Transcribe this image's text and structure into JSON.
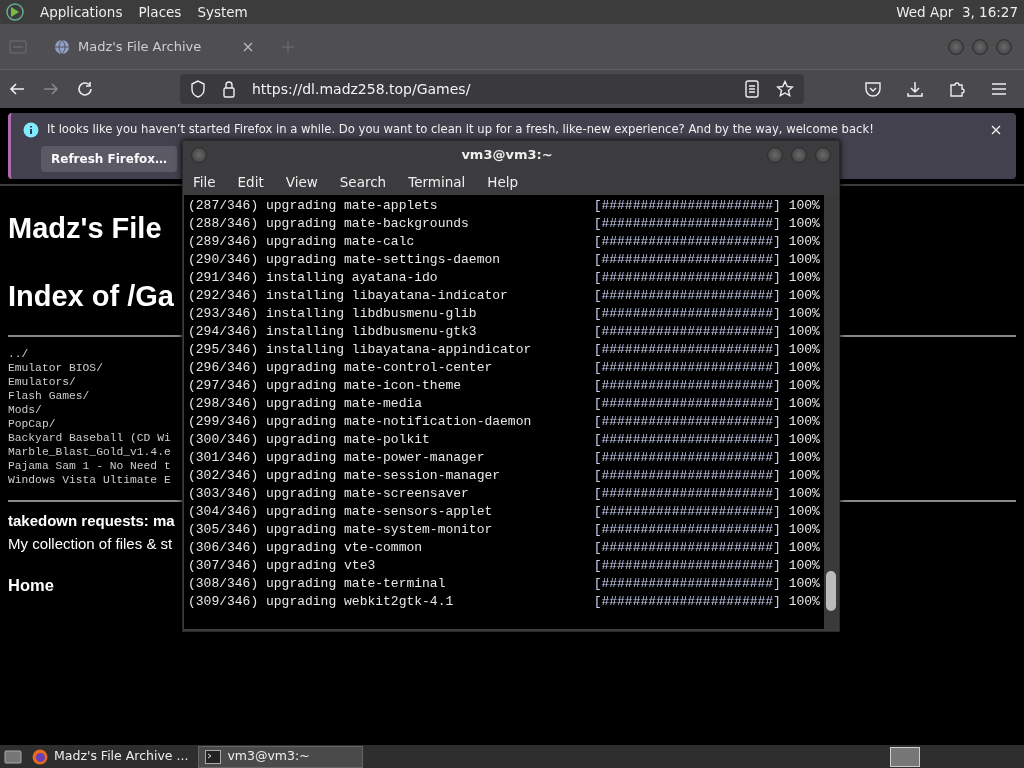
{
  "top_panel": {
    "menus": [
      "Applications",
      "Places",
      "System"
    ],
    "clock": "Wed Apr  3, 16:27"
  },
  "browser": {
    "tabs": [
      {
        "title": "Madz's File Archive",
        "selected": true
      }
    ],
    "url": "https://dl.madz258.top/Games/",
    "notification": {
      "message": "It looks like you haven’t started Firefox in a while. Do you want to clean it up for a fresh, like-new experience? And by the way, welcome back!",
      "button": "Refresh Firefox…"
    },
    "page": {
      "headings": [
        "Madz's File",
        "Index of /Ga"
      ],
      "listing": [
        "../",
        "Emulator BIOS/",
        "Emulators/",
        "Flash Games/",
        "Mods/",
        "PopCap/",
        "Backyard Baseball (CD Wi",
        "Marble_Blast_Gold_v1.4.e",
        "Pajama Sam 1 - No Need t",
        "Windows Vista Ultimate E"
      ],
      "contact": "takedown requests: ma",
      "description": "My collection of files & st",
      "home_link": "Home"
    }
  },
  "terminal": {
    "title": "vm3@vm3:~",
    "menus": [
      "File",
      "Edit",
      "View",
      "Search",
      "Terminal",
      "Help"
    ],
    "lines": [
      {
        "text": "(287/346) upgrading mate-applets",
        "bar": "[######################]",
        "percent": "100%"
      },
      {
        "text": "(288/346) upgrading mate-backgrounds",
        "bar": "[######################]",
        "percent": "100%"
      },
      {
        "text": "(289/346) upgrading mate-calc",
        "bar": "[######################]",
        "percent": "100%"
      },
      {
        "text": "(290/346) upgrading mate-settings-daemon",
        "bar": "[######################]",
        "percent": "100%"
      },
      {
        "text": "(291/346) installing ayatana-ido",
        "bar": "[######################]",
        "percent": "100%"
      },
      {
        "text": "(292/346) installing libayatana-indicator",
        "bar": "[######################]",
        "percent": "100%"
      },
      {
        "text": "(293/346) installing libdbusmenu-glib",
        "bar": "[######################]",
        "percent": "100%"
      },
      {
        "text": "(294/346) installing libdbusmenu-gtk3",
        "bar": "[######################]",
        "percent": "100%"
      },
      {
        "text": "(295/346) installing libayatana-appindicator",
        "bar": "[######################]",
        "percent": "100%"
      },
      {
        "text": "(296/346) upgrading mate-control-center",
        "bar": "[######################]",
        "percent": "100%"
      },
      {
        "text": "(297/346) upgrading mate-icon-theme",
        "bar": "[######################]",
        "percent": "100%"
      },
      {
        "text": "(298/346) upgrading mate-media",
        "bar": "[######################]",
        "percent": "100%"
      },
      {
        "text": "(299/346) upgrading mate-notification-daemon",
        "bar": "[######################]",
        "percent": "100%"
      },
      {
        "text": "(300/346) upgrading mate-polkit",
        "bar": "[######################]",
        "percent": "100%"
      },
      {
        "text": "(301/346) upgrading mate-power-manager",
        "bar": "[######################]",
        "percent": "100%"
      },
      {
        "text": "(302/346) upgrading mate-session-manager",
        "bar": "[######################]",
        "percent": "100%"
      },
      {
        "text": "(303/346) upgrading mate-screensaver",
        "bar": "[######################]",
        "percent": "100%"
      },
      {
        "text": "(304/346) upgrading mate-sensors-applet",
        "bar": "[######################]",
        "percent": "100%"
      },
      {
        "text": "(305/346) upgrading mate-system-monitor",
        "bar": "[######################]",
        "percent": "100%"
      },
      {
        "text": "(306/346) upgrading vte-common",
        "bar": "[######################]",
        "percent": "100%"
      },
      {
        "text": "(307/346) upgrading vte3",
        "bar": "[######################]",
        "percent": "100%"
      },
      {
        "text": "(308/346) upgrading mate-terminal",
        "bar": "[######################]",
        "percent": "100%"
      },
      {
        "text": "(309/346) upgrading webkit2gtk-4.1",
        "bar": "[######################]",
        "percent": "100%"
      }
    ]
  },
  "taskbar": {
    "items": [
      {
        "label": "Madz's File Archive ...",
        "kind": "browser",
        "selected": false
      },
      {
        "label": "vm3@vm3:~",
        "kind": "terminal",
        "selected": true
      }
    ]
  }
}
